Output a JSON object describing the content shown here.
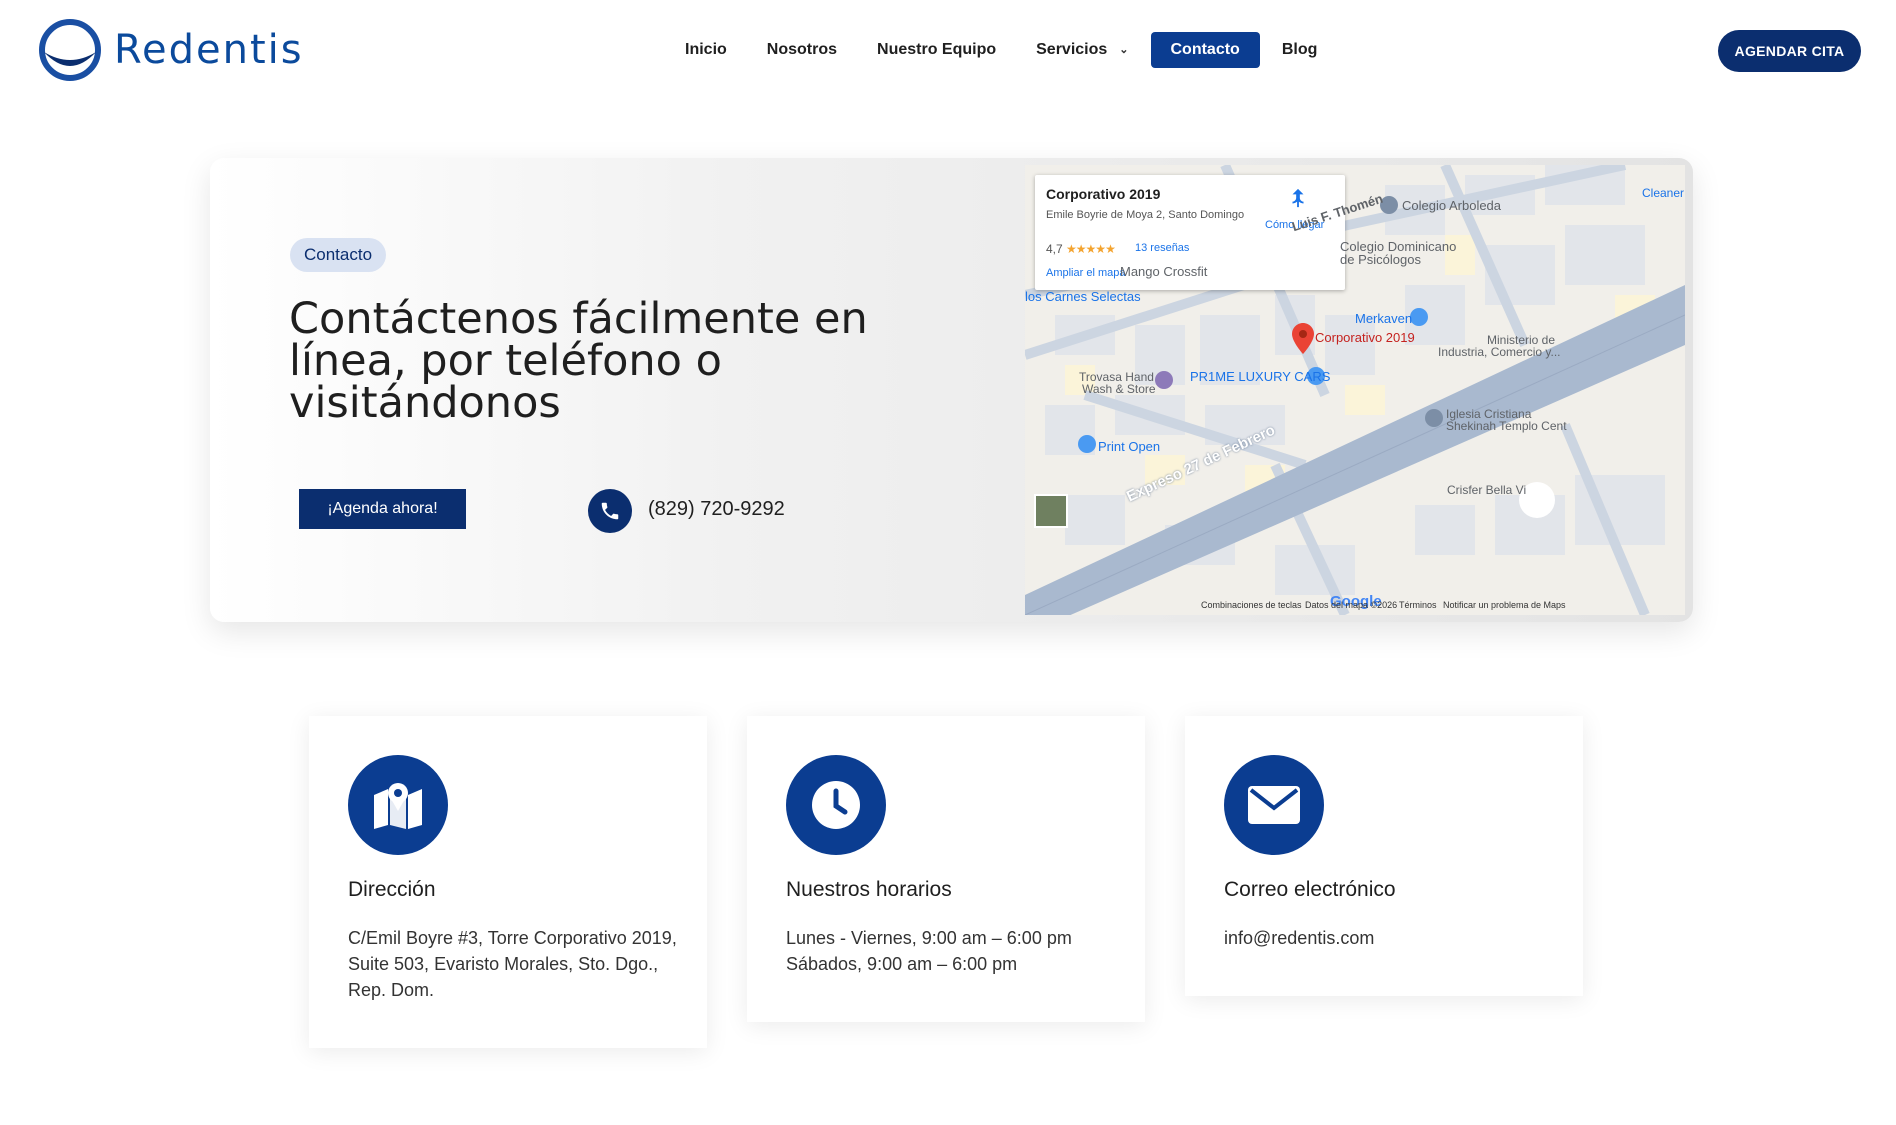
{
  "brand": {
    "name": "Redentis",
    "color": "#0b4a9c"
  },
  "nav": {
    "items": [
      {
        "label": "Inicio"
      },
      {
        "label": "Nosotros"
      },
      {
        "label": "Nuestro Equipo"
      },
      {
        "label": "Servicios"
      },
      {
        "label": "Contacto",
        "active": true
      },
      {
        "label": "Blog"
      }
    ]
  },
  "header": {
    "cta_label": "AGENDAR CITA"
  },
  "hero": {
    "pill": "Contacto",
    "title": "Contáctenos fácilmente en línea, por teléfono o visitándonos",
    "button": "¡Agenda ahora!",
    "phone": "(829) 720-9292"
  },
  "map": {
    "place_title": "Corporativo 2019",
    "address": "Emile Boyrie de Moya 2, Santo Domingo",
    "rating": "4,7",
    "stars": "★★★★★",
    "reviews": "13 reseñas",
    "expand": "Ampliar el mapa",
    "directions": "Cómo llegar",
    "labels": {
      "thomen": "Luis F. Thomén",
      "arboleda": "Colegio Arboleda",
      "cleaner": "Cleaner Luxu",
      "psicologos_1": "Colegio Dominicano",
      "psicologos_2": "de Psicólogos",
      "mango": "Mango Crossfit",
      "carnes": "los Carnes Selectas",
      "merkaven": "Merkaven",
      "pin": "Corporativo 2019",
      "ministerio_1": "Ministerio de",
      "ministerio_2": "Industria, Comercio y...",
      "trovasa_1": "Trovasa Hand",
      "trovasa_2": "Wash & Store",
      "prime": "PR1ME LUXURY CARS",
      "iglesia_1": "Iglesia Cristiana",
      "iglesia_2": "Shekinah Templo Cent",
      "print": "Print Open",
      "expreso": "Expreso 27 de Febrero",
      "crisfer": "Crisfer Bella Vi",
      "google": "Google"
    },
    "footer": {
      "shortcuts": "Combinaciones de teclas",
      "data": "Datos del mapa ©2026",
      "terms": "Términos",
      "report": "Notificar un problema de Maps"
    }
  },
  "cards": [
    {
      "icon": "map-icon",
      "title": "Dirección",
      "body": "C/Emil Boyre #3, Torre Corporativo 2019, Suite 503, Evaristo Morales, Sto. Dgo., Rep. Dom."
    },
    {
      "icon": "clock-icon",
      "title": "Nuestros horarios",
      "body_lines": [
        "Lunes - Viernes, 9:00 am – 6:00 pm",
        "Sábados, 9:00 am – 6:00 pm"
      ]
    },
    {
      "icon": "envelope-icon",
      "title": "Correo electrónico",
      "body": "info@redentis.com"
    }
  ],
  "colors": {
    "primary": "#0b3d91",
    "dark": "#0b2e6f",
    "pill_bg": "#d9e2f2"
  }
}
